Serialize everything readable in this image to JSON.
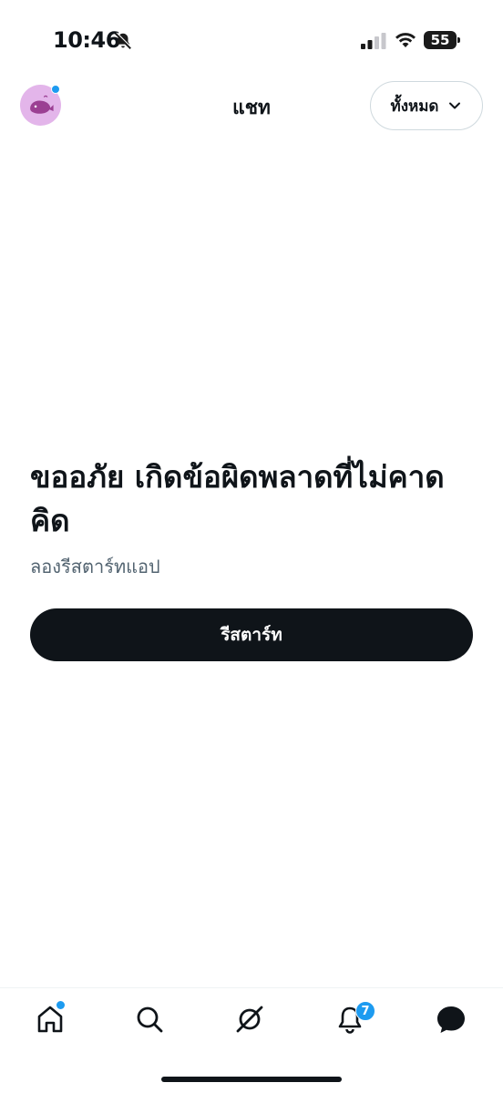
{
  "status_bar": {
    "time": "10:46",
    "battery": "55",
    "icons": [
      "bell-off-icon",
      "cellular-signal-icon",
      "wifi-icon",
      "battery-icon"
    ]
  },
  "header": {
    "title": "แชท",
    "filter_label": "ทั้งหมด",
    "avatar_icon": "whale-avatar-icon",
    "avatar_color": "#e3b5ea"
  },
  "error": {
    "title": "ขออภัย เกิดข้อผิดพลาดที่ไม่คาดคิด",
    "subtitle": "ลองรีสตาร์ทแอป",
    "button_label": "รีสตาร์ท"
  },
  "bottom_nav": {
    "items": [
      "home-icon",
      "search-icon",
      "grok-icon",
      "notifications-icon",
      "messages-icon"
    ],
    "notification_count": "7"
  },
  "colors": {
    "accent": "#1d9bf0",
    "text_primary": "#0f1419",
    "text_secondary": "#536471",
    "button_bg": "#0f1419"
  }
}
